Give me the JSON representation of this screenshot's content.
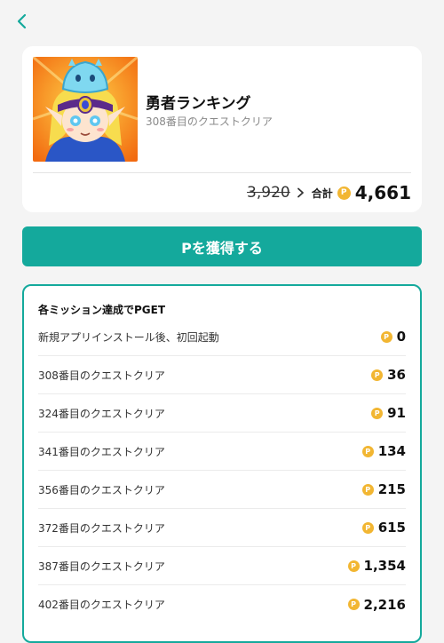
{
  "colors": {
    "accent": "#14a99c",
    "coin": "#f2b632",
    "background": "#f4f4f4"
  },
  "nav": {
    "back_icon": "chevron-left-icon"
  },
  "app": {
    "title": "勇者ランキング",
    "subtitle": "308番目のクエストクリア",
    "icon": "app-icon-hero-character"
  },
  "points": {
    "original": "3,920",
    "total_label": "合計",
    "coin_symbol": "P",
    "total": "4,661"
  },
  "cta": {
    "label": "Pを獲得する"
  },
  "missions": {
    "title": "各ミッション達成でPGET",
    "coin_symbol": "P",
    "items": [
      {
        "label": "新規アプリインストール後、初回起動",
        "points": "0"
      },
      {
        "label": "308番目のクエストクリア",
        "points": "36"
      },
      {
        "label": "324番目のクエストクリア",
        "points": "91"
      },
      {
        "label": "341番目のクエストクリア",
        "points": "134"
      },
      {
        "label": "356番目のクエストクリア",
        "points": "215"
      },
      {
        "label": "372番目のクエストクリア",
        "points": "615"
      },
      {
        "label": "387番目のクエストクリア",
        "points": "1,354"
      },
      {
        "label": "402番目のクエストクリア",
        "points": "2,216"
      }
    ]
  }
}
